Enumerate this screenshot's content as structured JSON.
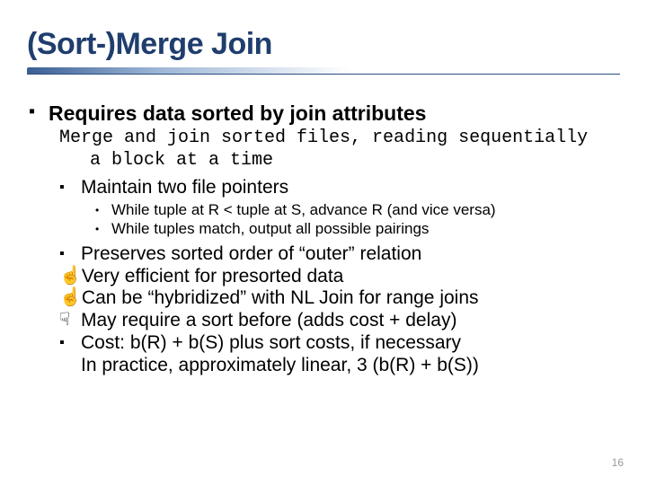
{
  "title": "(Sort-)Merge Join",
  "b1": {
    "bullet": "▪",
    "text": "Requires data sorted by join attributes"
  },
  "mono_line1": "Merge and join sorted files, reading sequentially",
  "mono_line2": "a block at a time",
  "b2a": {
    "bullet": "▪",
    "text": "Maintain two file pointers"
  },
  "b3a": {
    "bullet": "•",
    "text": "While tuple at R < tuple at S, advance R (and vice versa)"
  },
  "b3b": {
    "bullet": "•",
    "text": "While tuples match, output all possible pairings"
  },
  "r1": {
    "bullet": "▪",
    "text": "Preserves sorted order of “outer” relation"
  },
  "r2": {
    "bullet": "ͻ",
    "text": "Very efficient for presorted data"
  },
  "r3": {
    "bullet": "ͻ",
    "text": "Can be “hybridized” with NL Join for range joins"
  },
  "r4": {
    "bullet": "Ͻ",
    "text": "May require a sort before (adds cost + delay)"
  },
  "r5": {
    "bullet": "▪",
    "text": "Cost:  b(R) + b(S)   plus sort costs, if necessary"
  },
  "r5b": "In practice, approximately linear, 3 (b(R) + b(S))",
  "pagenum": "16",
  "hand_up": "☝",
  "hand_down": "☟"
}
